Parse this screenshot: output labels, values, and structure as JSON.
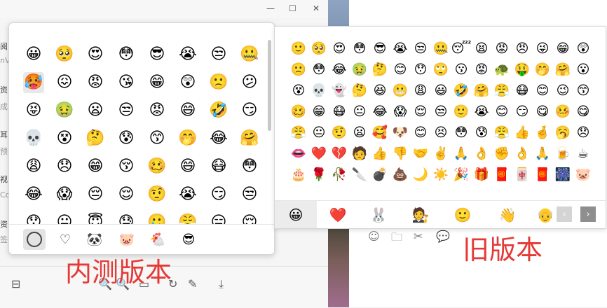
{
  "window_controls": {
    "minimize": "—",
    "maximize": "☐",
    "close": "✕"
  },
  "left_sidebar_fragments": [
    {
      "text": "阅"
    },
    {
      "text": "nV"
    },
    {
      "text": "资"
    },
    {
      "text": "成"
    },
    {
      "text": "耳"
    },
    {
      "text": "预"
    },
    {
      "text": "视"
    },
    {
      "text": "Co"
    },
    {
      "text": "资"
    },
    {
      "text": "签"
    }
  ],
  "new_panel": {
    "emojis": [
      "😀",
      "🥺",
      "😍",
      "😳",
      "😎",
      "😭",
      "😒",
      "🤐",
      "🥵",
      "😖",
      "😡",
      "😘",
      "😁",
      "😲",
      "🙁",
      "😕",
      "😝",
      "🤢",
      "😦",
      "😒",
      "😡",
      "😄",
      "🤣",
      "😏",
      "💀",
      "😵",
      "🤔",
      "😰",
      "😙",
      "🤭",
      "😂",
      "🤗",
      "😩",
      "😞",
      "😁",
      "😚",
      "🥴",
      "😄",
      "😷",
      "😳",
      "😂",
      "😱",
      "😔",
      "😌",
      "🤨",
      "😭",
      "😏",
      "😒",
      "😯",
      "😐",
      "😇",
      "😓",
      "🥲",
      "😤",
      "😑",
      "😌"
    ],
    "tabs": [
      "☺",
      "♡",
      "🐼",
      "🐷",
      "🐔",
      "😎"
    ]
  },
  "old_panel": {
    "emojis": [
      "🙂",
      "🥺",
      "😍",
      "😳",
      "😎",
      "😭",
      "😒",
      "🤐",
      "😴",
      "😫",
      "😡",
      "😠",
      "😜",
      "😁",
      "😲",
      "🙁",
      "😳",
      "😂",
      "🤢",
      "🤔",
      "😊",
      "😯",
      "🙄",
      "😗",
      "😡",
      "🐢",
      "🤑",
      "🤭",
      "🤗",
      "😮",
      "😵",
      "💀",
      "👻",
      "🤔",
      "😆",
      "😬",
      "😩",
      "😃",
      "🤣",
      "🤗",
      "😤",
      "😷",
      "😊",
      "😉",
      "😙",
      "🥴",
      "😁",
      "😷",
      "😐",
      "😂",
      "😱",
      "😌",
      "😒",
      "🙂",
      "😭",
      "😊",
      "😏",
      "😋",
      "🤒",
      "😋",
      "😤",
      "😐",
      "🤨",
      "😦",
      "🥰",
      "🐶",
      "😊",
      "😣",
      "😳",
      "😰",
      "😤",
      "👍",
      "🤞",
      "🥱",
      "😞",
      "👄",
      "❤️",
      "💔",
      "🧑",
      "👍",
      "👎",
      "🤝",
      "✌️",
      "🙏",
      "👌",
      "✊",
      "👌",
      "🙏",
      "🍺",
      "☕",
      "🎂",
      "🌹",
      "🥀",
      "🔪",
      "💣",
      "💩",
      "🌙",
      "☀️",
      "🎉",
      "🎁",
      "🧧",
      "🀄",
      "🧧",
      "🎆",
      "🐷"
    ],
    "tabs": [
      "😀",
      "❤️",
      "🐰",
      "🧑‍⚖️",
      "🙂",
      "👋",
      "👴"
    ],
    "prev": "‹",
    "next": "›"
  },
  "left_toolbar_icons": [
    "⊟",
    "🔍",
    "🔍",
    "▭",
    "↻",
    "✎",
    "⤓"
  ],
  "right_bottom_icons": [
    "☺",
    "🗀",
    "✂",
    "💬"
  ],
  "labels": {
    "new_version": "内测版本",
    "old_version": "旧版本"
  }
}
